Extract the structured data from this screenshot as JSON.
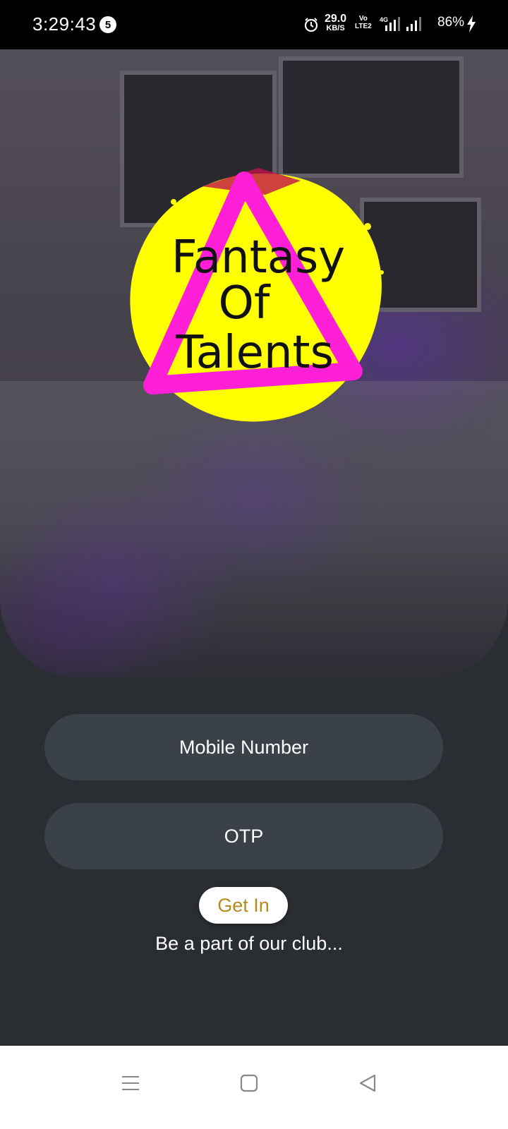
{
  "status_bar": {
    "time": "3:29:43",
    "notification_count": "5",
    "net_speed_value": "29.0",
    "net_speed_unit": "KB/S",
    "volte_line1": "Vo",
    "volte_line2": "LTE2",
    "network_type": "4G",
    "battery": "86%",
    "icons": [
      "alarm-icon",
      "signal-icon",
      "signal-icon",
      "charging-icon"
    ]
  },
  "hero": {
    "logo_text_line1": "Fantasy",
    "logo_text_line2": "Of",
    "logo_text_line3": "Talents",
    "logo_colors": {
      "splash": "#ffff00",
      "triangle": "#ff1fd6",
      "text": "#111111"
    }
  },
  "form": {
    "mobile_placeholder": "Mobile Number",
    "otp_placeholder": "OTP",
    "submit_label": "Get In",
    "tagline": "Be a part of our club..."
  },
  "navbar": {
    "icons": [
      "menu-icon",
      "home-square-icon",
      "back-triangle-icon"
    ]
  },
  "colors": {
    "background": "#2a2d31",
    "field": "#3b4148",
    "accent_text": "#b58b1e"
  }
}
